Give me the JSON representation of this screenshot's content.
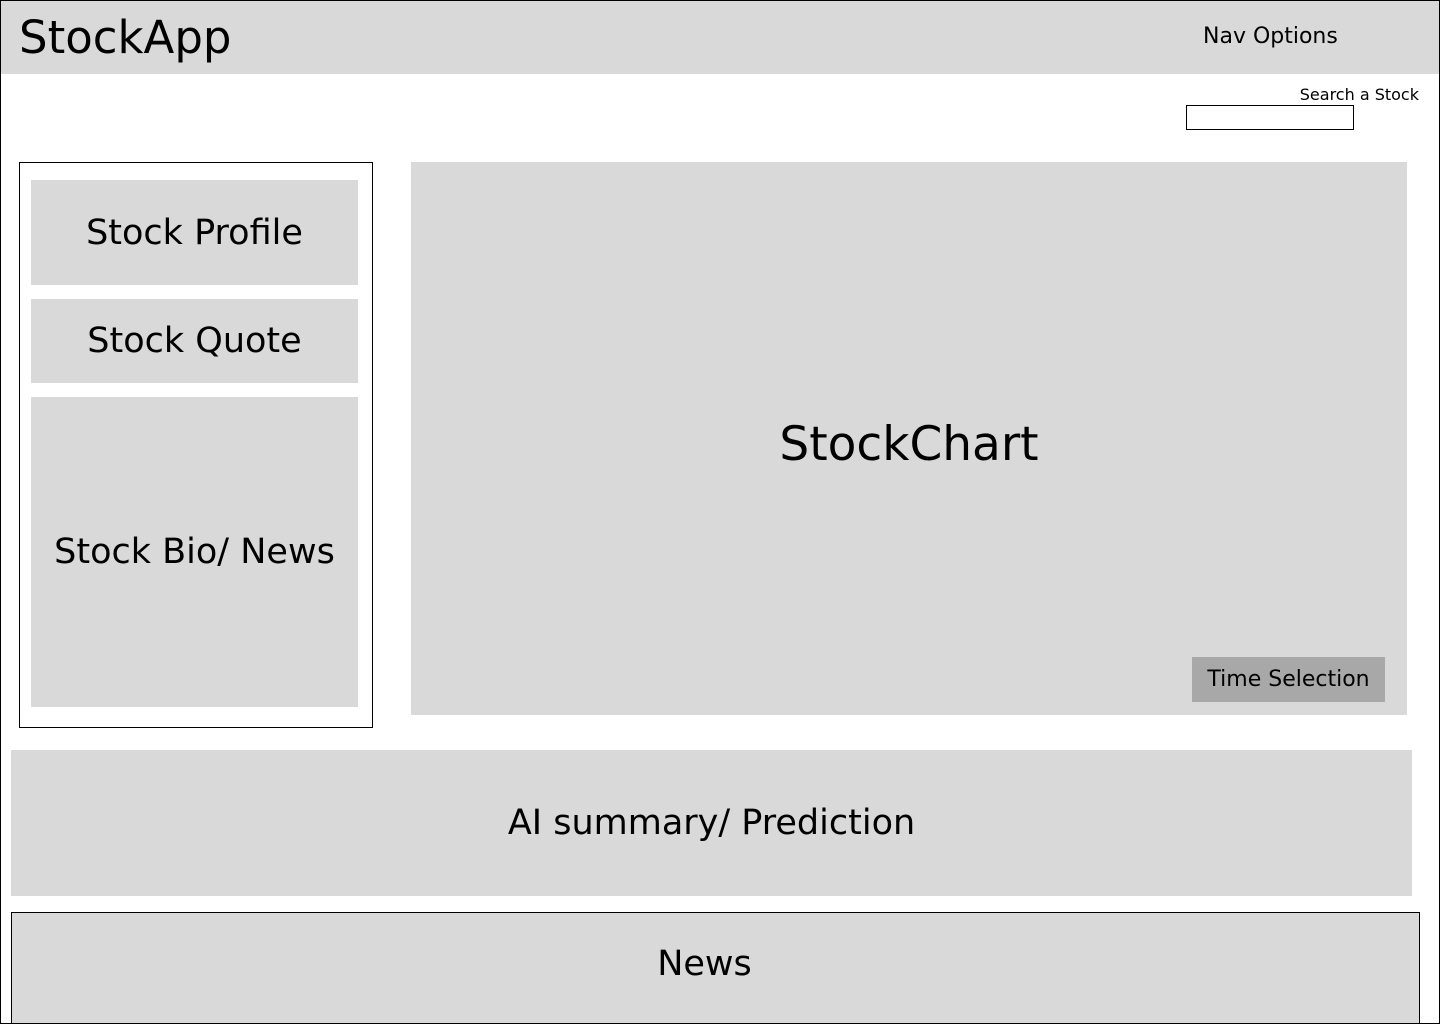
{
  "header": {
    "app_title": "StockApp",
    "nav_label": "Nav Options"
  },
  "search": {
    "label": "Search a Stock",
    "value": ""
  },
  "sidebar": {
    "profile_label": "Stock Profile",
    "quote_label": "Stock Quote",
    "bio_label": "Stock Bio/ News"
  },
  "chart": {
    "title": "StockChart",
    "time_selection_label": "Time Selection"
  },
  "ai_summary": {
    "label": "AI summary/ Prediction"
  },
  "news": {
    "label": "News"
  },
  "colors": {
    "panel_bg": "#d9d9d9",
    "button_bg": "#a8a8a8",
    "border": "#000000"
  }
}
